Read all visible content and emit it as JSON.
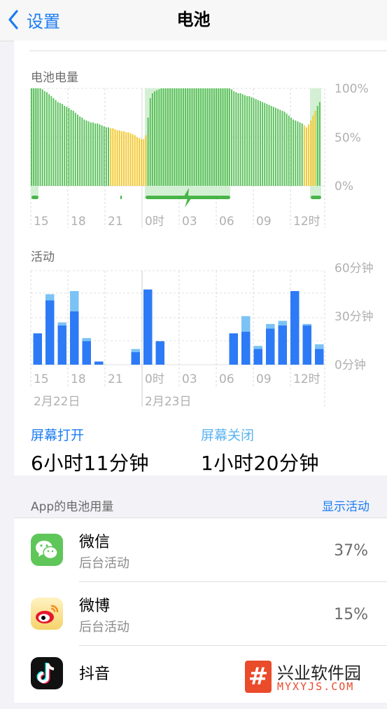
{
  "nav": {
    "back_label": "设置",
    "title": "电池"
  },
  "battery_chart": {
    "label": "电池电量",
    "y_ticks": [
      "100%",
      "50%",
      "0%"
    ],
    "x_ticks": [
      "15",
      "18",
      "21",
      "0时",
      "03",
      "06",
      "09",
      "12时"
    ],
    "colors": {
      "normal": "#5ac05a",
      "low_power": "#f2c82e",
      "charging_bg": "#d4f0d4",
      "charging_bar": "#49b549"
    }
  },
  "activity_chart": {
    "label": "活动",
    "y_ticks": [
      "60分钟",
      "30分钟",
      "0分钟"
    ],
    "x_ticks": [
      "15",
      "18",
      "21",
      "0时",
      "03",
      "06",
      "09",
      "12时"
    ],
    "date_labels": [
      "2月22日",
      "2月23日"
    ],
    "colors": {
      "screen_on": "#2d7af6",
      "screen_off": "#7cc3f5"
    }
  },
  "chart_data": [
    {
      "type": "bar",
      "title": "电池电量",
      "ylim": [
        0,
        100
      ],
      "x_ticks": [
        "15",
        "18",
        "21",
        "0时",
        "03",
        "06",
        "09",
        "12时"
      ],
      "values": [
        100,
        100,
        100,
        100,
        100,
        99,
        97,
        96,
        94,
        92,
        90,
        88,
        86,
        85,
        84,
        82,
        81,
        80,
        78,
        77,
        75,
        73,
        71,
        70,
        68,
        67,
        66,
        65,
        65,
        64,
        64,
        63,
        62,
        61,
        60,
        60,
        59,
        59,
        58,
        57,
        57,
        56,
        56,
        55,
        55,
        54,
        53,
        52,
        50,
        49,
        48,
        48,
        52,
        70,
        90,
        95,
        97,
        98,
        99,
        100,
        100,
        100,
        100,
        100,
        100,
        100,
        100,
        100,
        100,
        100,
        100,
        100,
        100,
        100,
        100,
        100,
        100,
        100,
        100,
        100,
        100,
        100,
        100,
        100,
        100,
        100,
        100,
        100,
        100,
        100,
        100,
        99,
        97,
        96,
        95,
        95,
        94,
        93,
        92,
        92,
        91,
        90,
        89,
        88,
        87,
        86,
        85,
        84,
        83,
        82,
        81,
        80,
        79,
        78,
        77,
        76,
        74,
        72,
        70,
        68,
        67,
        66,
        65,
        64,
        62,
        60,
        63,
        67,
        72,
        77,
        82,
        86
      ]
    },
    {
      "type": "bar",
      "title": "活动",
      "ylim": [
        0,
        60
      ],
      "x_ticks": [
        "15",
        "18",
        "21",
        "0时",
        "03",
        "06",
        "09",
        "12时"
      ],
      "series": [
        {
          "name": "屏幕打开",
          "values": [
            20,
            41,
            25,
            34,
            15,
            2,
            0,
            0,
            8,
            48,
            15,
            0,
            0,
            0,
            0,
            0,
            20,
            21,
            10,
            23,
            25,
            47,
            25,
            10
          ]
        },
        {
          "name": "屏幕关闭",
          "values": [
            0,
            4,
            2,
            13,
            2,
            0,
            0,
            0,
            2,
            0,
            0,
            0,
            0,
            0,
            0,
            0,
            0,
            10,
            2,
            3,
            3,
            0,
            1,
            3
          ]
        }
      ]
    }
  ],
  "stats": {
    "on_label": "屏幕打开",
    "on_value": "6小时11分钟",
    "off_label": "屏幕关闭",
    "off_value": "1小时20分钟",
    "on_color": "#1b7cf2",
    "off_color": "#5ab4f0"
  },
  "apps": {
    "header": "App的电池用量",
    "show_activity": "显示活动",
    "items": [
      {
        "name": "微信",
        "sub": "后台活动",
        "pct": "37%",
        "icon": "wechat-icon"
      },
      {
        "name": "微博",
        "sub": "后台活动",
        "pct": "15%",
        "icon": "weibo-icon"
      },
      {
        "name": "抖音",
        "sub": "",
        "pct": "",
        "icon": "douyin-icon"
      }
    ]
  },
  "watermark": {
    "logo_text": "#",
    "cn": "兴业软件园",
    "en": "MYXYJS.COM"
  }
}
